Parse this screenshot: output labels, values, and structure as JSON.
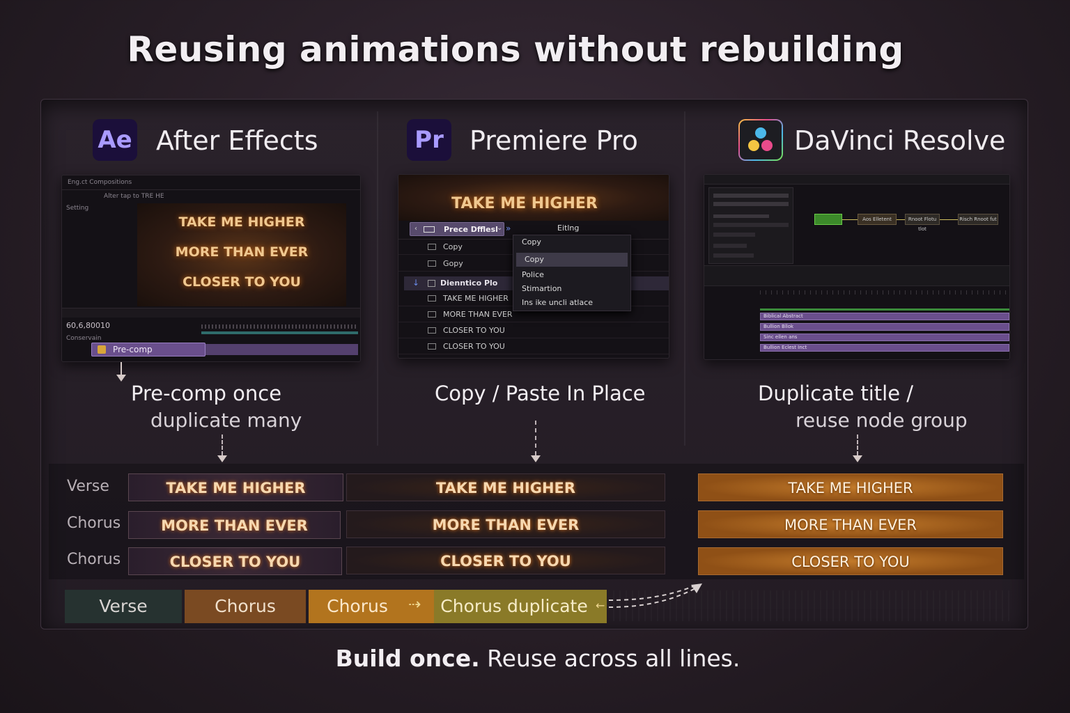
{
  "headline": "Reusing animations without rebuilding",
  "apps": {
    "ae": {
      "logo": "Ae",
      "name": "After Effects"
    },
    "pr": {
      "logo": "Pr",
      "name": "Premiere Pro"
    },
    "dv": {
      "name": "DaVinci Resolve",
      "logo_colors": [
        "#f4c542",
        "#e94b8b",
        "#4bb8e9"
      ]
    }
  },
  "ae_shot": {
    "panel_title": "Eng.ct Compositions",
    "tab": "Alter tap to TRE HE",
    "side_label": "Setting",
    "lines": [
      "TAKE ME HIGHER",
      "MORE THAN EVER",
      "CLOSER TO YOU"
    ],
    "timecode": "60,6,80010",
    "layer_header": "Conservain",
    "layer_name": "Pre-comp"
  },
  "pr_shot": {
    "preview_title": "TAKE ME HIGHER",
    "clip_label": "Prece Dfflesl",
    "editing_label": "Eitlng",
    "rows": [
      "Copy",
      "Gopy"
    ],
    "bin_name": "Dienntico Plo",
    "bin_rows": [
      "TAKE ME HIGHER",
      "MORE THAN EVER",
      "CLOSER TO YOU",
      "CLOSER TO YOU"
    ],
    "menu": [
      "Copy",
      "Copy",
      "Police",
      "Stimartion",
      "Ins ike uncli atlace"
    ]
  },
  "dv_shot": {
    "nodes": [
      "Aos Elletent",
      "Rnoot Flotu tlot",
      "Risch Rnoot fut"
    ],
    "tracks": [
      "Biblical Abstract",
      "Bullion Bllok",
      "Sinc ellen ans",
      "Bullion Eclest Inct"
    ]
  },
  "captions": {
    "ae_1": "Pre-comp once",
    "ae_2": "duplicate many",
    "pr_1": "Copy / Paste In Place",
    "dv_1": "Duplicate title /",
    "dv_2": "reuse node group"
  },
  "rows": [
    {
      "label": "Verse",
      "lyric": "TAKE ME HIGHER"
    },
    {
      "label": "Chorus",
      "lyric": "MORE THAN EVER"
    },
    {
      "label": "Chorus",
      "lyric": "CLOSER TO YOU"
    }
  ],
  "timeline": {
    "segments": [
      "Verse",
      "Chorus",
      "Chorus",
      "Chorus duplicate"
    ],
    "colors": [
      "#263230",
      "#7a4a22",
      "#b2741e",
      "#8a7a28"
    ]
  },
  "tagline": {
    "bold": "Build once.",
    "rest": "Reuse across all lines."
  }
}
